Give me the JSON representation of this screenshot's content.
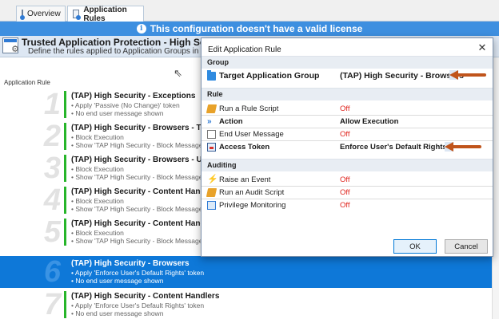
{
  "tabs": [
    {
      "label": "Overview"
    },
    {
      "label": "Application Rules"
    }
  ],
  "banner": {
    "text": "This configuration doesn't have a valid license"
  },
  "header": {
    "title": "Trusted Application Protection - High Securi",
    "description": "Define the rules applied to Application Groups in this"
  },
  "column_header": "Application Rule",
  "rules": [
    {
      "number": "1",
      "title": "(TAP) High Security - Exceptions",
      "line1": "• Apply 'Passive (No Change)' token",
      "line2": "• No end user message shown"
    },
    {
      "number": "2",
      "title": "(TAP) High Security - Browsers - Truste",
      "line1": "• Block Execution",
      "line2": "• Show 'TAP High Security - Block Message' m"
    },
    {
      "number": "3",
      "title": "(TAP) High Security - Browsers - Untrus",
      "line1": "• Block Execution",
      "line2": "• Show 'TAP High Security - Block Message' m"
    },
    {
      "number": "4",
      "title": "(TAP) High Security - Content Handlers",
      "line1": "• Block Execution",
      "line2": "• Show 'TAP High Security - Block Message' m"
    },
    {
      "number": "5",
      "title": "(TAP) High Security - Content Handlers",
      "line1": "• Block Execution",
      "line2": "• Show 'TAP High Security - Block Message' m"
    },
    {
      "number": "6",
      "title": "(TAP) High Security - Browsers",
      "line1": "• Apply 'Enforce User's Default Rights' token",
      "line2": "• No end user message shown",
      "selected": true
    },
    {
      "number": "7",
      "title": "(TAP) High Security - Content Handlers",
      "line1": "• Apply 'Enforce User's Default Rights' token",
      "line2": "• No end user message shown"
    }
  ],
  "dialog": {
    "title": "Edit Application Rule",
    "close_glyph": "✕",
    "sections": {
      "group": "Group",
      "rule": "Rule",
      "auditing": "Auditing"
    },
    "group": {
      "label": "Target Application Group",
      "value": "(TAP) High Security - Browsers",
      "icon": "folder-icon"
    },
    "rule_rows": [
      {
        "label": "Run a Rule Script",
        "value": "Off",
        "icon": "script-icon"
      },
      {
        "label": "Action",
        "value": "Allow Execution",
        "icon": "action-icon"
      },
      {
        "label": "End User Message",
        "value": "Off",
        "icon": "message-icon"
      },
      {
        "label": "Access Token",
        "value": "Enforce User's Default Rights",
        "icon": "token-icon"
      }
    ],
    "auditing_rows": [
      {
        "label": "Raise an Event",
        "value": "Off",
        "icon": "event-icon"
      },
      {
        "label": "Run an Audit Script",
        "value": "Off",
        "icon": "script-icon"
      },
      {
        "label": "Privilege Monitoring",
        "value": "Off",
        "icon": "monitor-icon"
      }
    ],
    "ok_label": "OK",
    "cancel_label": "Cancel"
  },
  "colors": {
    "banner": "#3d8fe0",
    "selection": "#0e78d8",
    "rule_bar": "#27b52a",
    "off_value": "#e0261f",
    "annotation_arrow": "#c0541b"
  }
}
